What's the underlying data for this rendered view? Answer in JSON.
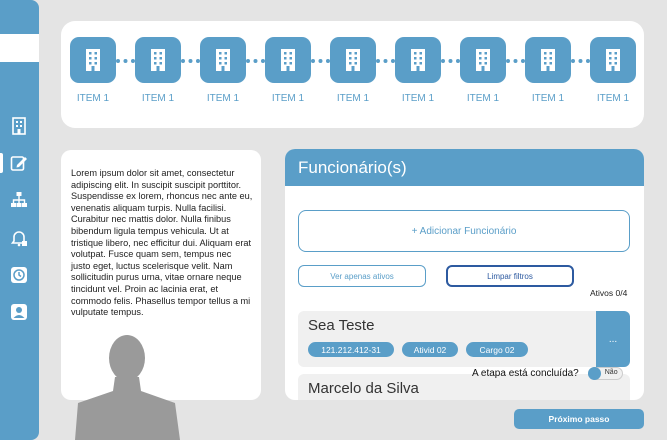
{
  "sidebar": {
    "items": [
      {
        "icon": "building-icon"
      },
      {
        "icon": "edit-icon"
      },
      {
        "icon": "org-chart-icon"
      },
      {
        "icon": "notification-bell-icon"
      },
      {
        "icon": "history-icon"
      },
      {
        "icon": "user-icon"
      }
    ]
  },
  "stepper": {
    "items": [
      {
        "label": "ITEM 1"
      },
      {
        "label": "ITEM 1"
      },
      {
        "label": "ITEM 1"
      },
      {
        "label": "ITEM 1"
      },
      {
        "label": "ITEM 1"
      },
      {
        "label": "ITEM 1"
      },
      {
        "label": "ITEM 1"
      },
      {
        "label": "ITEM 1"
      },
      {
        "label": "ITEM 1"
      }
    ]
  },
  "info_card": {
    "text": "Lorem ipsum dolor sit amet, consectetur adipiscing elit. In suscipit suscipit porttitor. Suspendisse ex lorem, rhoncus nec ante eu, venenatis aliquam turpis. Nulla facilisi. Curabitur nec mattis dolor. Nulla finibus bibendum ligula tempus vehicula. Ut at tristique libero, nec efficitur dui. Aliquam erat volutpat. Fusce quam sem, tempus nec justo eget, luctus scelerisque velit. Nam sollicitudin purus urna, vitae ornare neque tincidunt vel. Proin ac lacinia erat, et commodo felis. Phasellus tempor tellus a mi vulputate tempus."
  },
  "employees": {
    "title": "Funcionário(s)",
    "add_label": "+ Adicionar Funcionário",
    "filter_active_label": "Ver apenas ativos",
    "clear_filters_label": "Limpar filtros",
    "active_count": "Ativos 0/4",
    "rows": [
      {
        "name": "Sea Teste",
        "tags": [
          "121.212.412-31",
          "Ativid 02",
          "Cargo 02"
        ],
        "more": "..."
      },
      {
        "name": "Marcelo da Silva"
      }
    ]
  },
  "footer": {
    "step_done_label": "A etapa está concluída?",
    "toggle_label": "Não",
    "next_label": "Próximo passo"
  },
  "colors": {
    "accent": "#5a9ec8",
    "background": "#e4e4e4"
  }
}
